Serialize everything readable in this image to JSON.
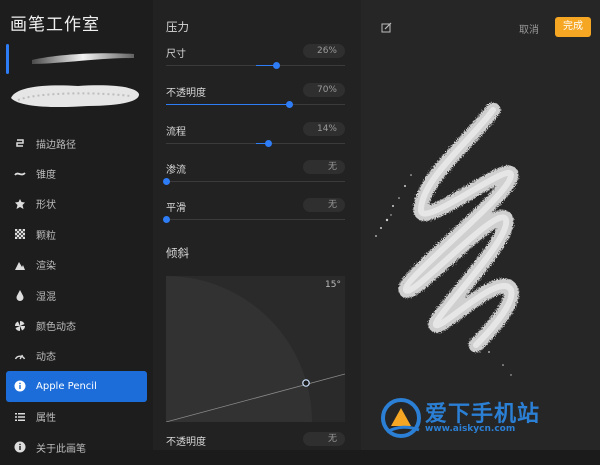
{
  "sidebar": {
    "title": "画笔工作室",
    "items": [
      {
        "label": "描边路径",
        "icon": "stroke-path-icon",
        "active": false
      },
      {
        "label": "锥度",
        "icon": "taper-icon",
        "active": false
      },
      {
        "label": "形状",
        "icon": "shape-icon",
        "active": false
      },
      {
        "label": "颗粒",
        "icon": "grain-icon",
        "active": false
      },
      {
        "label": "渲染",
        "icon": "render-icon",
        "active": false
      },
      {
        "label": "湿混",
        "icon": "wet-mix-icon",
        "active": false
      },
      {
        "label": "颜色动态",
        "icon": "color-dynamics-icon",
        "active": false
      },
      {
        "label": "动态",
        "icon": "dynamics-icon",
        "active": false
      },
      {
        "label": "Apple Pencil",
        "icon": "pencil-icon",
        "active": true
      },
      {
        "label": "属性",
        "icon": "properties-icon",
        "active": false
      },
      {
        "label": "关于此画笔",
        "icon": "info-icon",
        "active": false
      }
    ]
  },
  "panel": {
    "pressure_title": "压力",
    "pressure_rows": [
      {
        "label": "尺寸",
        "value": "26%",
        "level": 0.62,
        "fill_from": 0.5
      },
      {
        "label": "不透明度",
        "value": "70%",
        "level": 0.69,
        "fill_from": 0
      },
      {
        "label": "流程",
        "value": "14%",
        "level": 0.57,
        "fill_from": 0.5
      },
      {
        "label": "渗流",
        "value": "无",
        "level": 0.0,
        "fill_from": 0
      },
      {
        "label": "平滑",
        "value": "无",
        "level": 0.0,
        "fill_from": 0
      }
    ],
    "tilt_title": "倾斜",
    "tilt_degree": "15°",
    "tilt_opacity_label": "不透明度",
    "tilt_opacity_value": "无"
  },
  "canvas": {
    "cancel_label": "取消",
    "done_label": "完成",
    "accent": "#f5a623"
  },
  "watermark": {
    "text": "爱下手机站",
    "url": "www.aiskycn.com"
  },
  "colors": {
    "blue": "#2e7cf6",
    "sidebar_active": "#1c6dd9"
  }
}
